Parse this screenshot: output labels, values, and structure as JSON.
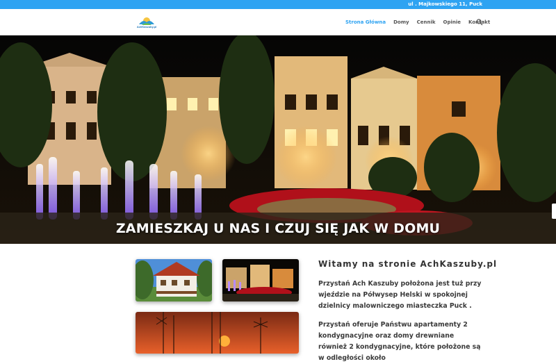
{
  "topbar": {
    "address": "ul . Majkowskiego 11, Puck"
  },
  "header": {
    "logo_text": "AchKaszuby.pl",
    "nav": [
      {
        "label": "Strona Główna"
      },
      {
        "label": "Domy"
      },
      {
        "label": "Cennik"
      },
      {
        "label": "Opinie"
      },
      {
        "label": "Kontakt"
      }
    ],
    "search_icon": "search-icon"
  },
  "hero": {
    "title": "ZAMIESZKAJ U NAS I CZUJ SIĘ JAK W DOMU"
  },
  "main": {
    "welcome_title": "Witamy na stronie AchKaszuby.pl",
    "paragraph_1": "Przystań Ach Kaszuby położona jest tuż przy wjeździe na Półwysep Helski w spokojnej dzielnicy malowniczego miasteczka Puck .",
    "paragraph_2": "Przystań oferuje Państwu apartamenty 2 kondygnacyjne oraz domy drewniane również 2 kondygnacyjne, które położone są w odległości około"
  },
  "colors": {
    "accent": "#2ea3f2",
    "text": "#3a3a3a"
  }
}
